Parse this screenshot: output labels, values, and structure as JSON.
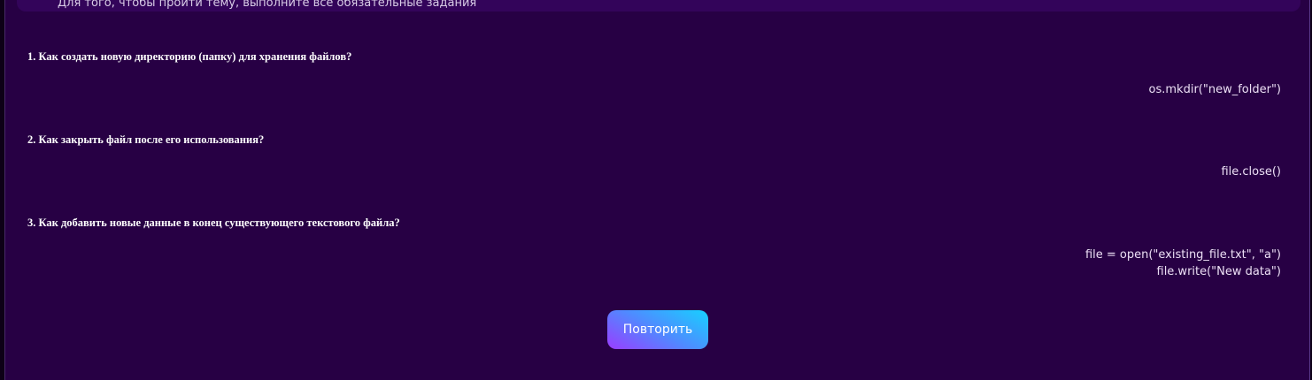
{
  "notice": "Для того, чтобы пройти тему, выполните все обязательные задания",
  "questions": [
    {
      "question": "1. Как создать новую директорию (папку) для хранения файлов?",
      "answer": [
        "os.mkdir(\"new_folder\")"
      ]
    },
    {
      "question": "2. Как закрыть файл после его использования?",
      "answer": [
        "file.close()"
      ]
    },
    {
      "question": "3.  Как добавить новые данные в конец существующего текстового файла?",
      "answer": [
        "file = open(\"existing_file.txt\", \"a\")",
        "file.write(\"New data\")"
      ]
    }
  ],
  "retry_button": "Повторить",
  "colors": {
    "background": "#270044",
    "button_gradient_start": "#9b3cff",
    "button_gradient_end": "#17d1ff"
  }
}
